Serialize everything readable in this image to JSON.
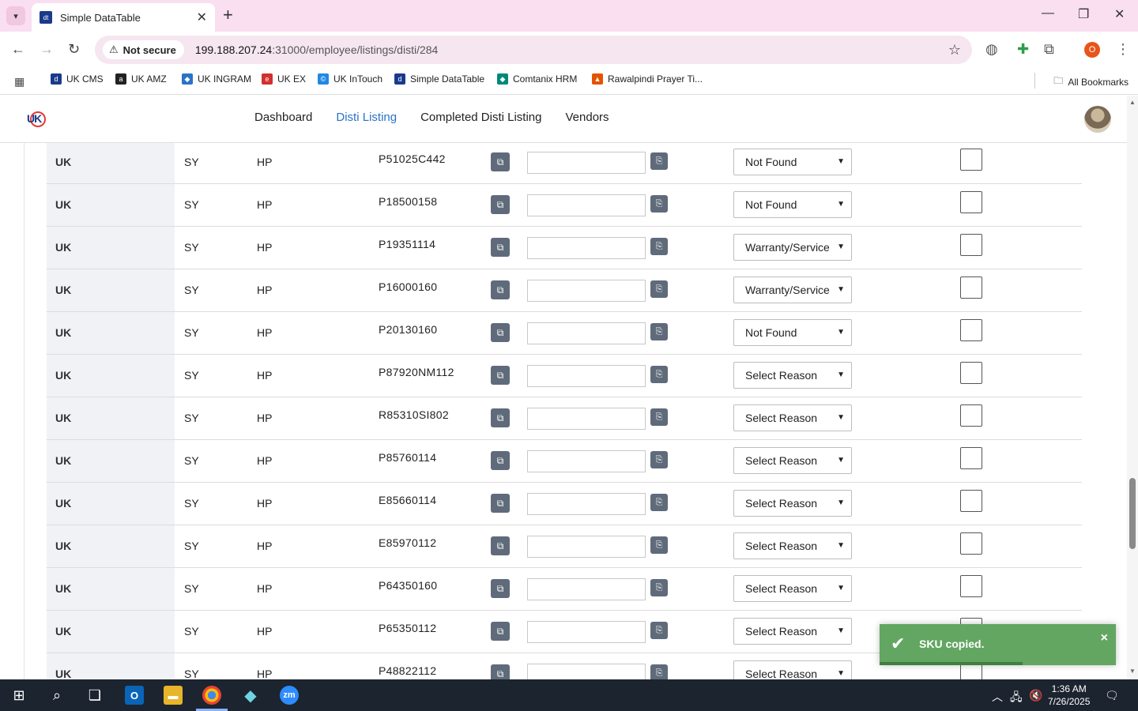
{
  "browser": {
    "tab_title": "Simple DataTable",
    "favicon_text": "dt",
    "new_tab_label": "+",
    "security_label": "Not secure",
    "url_host": "199.188.207.24",
    "url_path": ":31000/employee/listings/disti/284",
    "profile_initial": "O",
    "bookmarks": [
      {
        "label": "UK CMS",
        "icon": "dt-icon",
        "color": "#1a3a8c",
        "glyph": "d"
      },
      {
        "label": "UK AMZ",
        "icon": "amazon-icon",
        "color": "#222222",
        "glyph": "a"
      },
      {
        "label": "UK INGRAM",
        "icon": "ingram-icon",
        "color": "#2a73c8",
        "glyph": "◆"
      },
      {
        "label": "UK EX",
        "icon": "ex-icon",
        "color": "#d32f2f",
        "glyph": "e"
      },
      {
        "label": "UK InTouch",
        "icon": "intouch-icon",
        "color": "#1e88e5",
        "glyph": "©"
      },
      {
        "label": "Simple DataTable",
        "icon": "dt-icon",
        "color": "#1a3a8c",
        "glyph": "d"
      },
      {
        "label": "Comtanix HRM",
        "icon": "comtanix-icon",
        "color": "#00897b",
        "glyph": "◆"
      },
      {
        "label": "Rawalpindi Prayer Ti...",
        "icon": "prayer-icon",
        "color": "#e65100",
        "glyph": "▲"
      }
    ],
    "all_bookmarks_label": "All Bookmarks"
  },
  "site": {
    "nav": [
      {
        "label": "Dashboard",
        "active": false
      },
      {
        "label": "Disti Listing",
        "active": true
      },
      {
        "label": "Completed Disti Listing",
        "active": false
      },
      {
        "label": "Vendors",
        "active": false
      }
    ]
  },
  "table": {
    "rows": [
      {
        "region": "UK",
        "dist": "SY",
        "brand": "HP",
        "sku": "P51025C442",
        "reason": "Not Found"
      },
      {
        "region": "UK",
        "dist": "SY",
        "brand": "HP",
        "sku": "P18500158",
        "reason": "Not Found"
      },
      {
        "region": "UK",
        "dist": "SY",
        "brand": "HP",
        "sku": "P19351114",
        "reason": "Warranty/Service"
      },
      {
        "region": "UK",
        "dist": "SY",
        "brand": "HP",
        "sku": "P16000160",
        "reason": "Warranty/Service"
      },
      {
        "region": "UK",
        "dist": "SY",
        "brand": "HP",
        "sku": "P20130160",
        "reason": "Not Found"
      },
      {
        "region": "UK",
        "dist": "SY",
        "brand": "HP",
        "sku": "P87920NM112",
        "reason": "Select Reason"
      },
      {
        "region": "UK",
        "dist": "SY",
        "brand": "HP",
        "sku": "R85310SI802",
        "reason": "Select Reason"
      },
      {
        "region": "UK",
        "dist": "SY",
        "brand": "HP",
        "sku": "P85760114",
        "reason": "Select Reason"
      },
      {
        "region": "UK",
        "dist": "SY",
        "brand": "HP",
        "sku": "E85660114",
        "reason": "Select Reason"
      },
      {
        "region": "UK",
        "dist": "SY",
        "brand": "HP",
        "sku": "E85970112",
        "reason": "Select Reason"
      },
      {
        "region": "UK",
        "dist": "SY",
        "brand": "HP",
        "sku": "P64350160",
        "reason": "Select Reason"
      },
      {
        "region": "UK",
        "dist": "SY",
        "brand": "HP",
        "sku": "P65350112",
        "reason": "Select Reason"
      },
      {
        "region": "UK",
        "dist": "SY",
        "brand": "HP",
        "sku": "P48822112",
        "reason": "Select Reason"
      }
    ]
  },
  "toast": {
    "message": "SKU copied.",
    "close_glyph": "×",
    "color": "#62a662"
  },
  "taskbar": {
    "time": "1:36 AM",
    "date": "7/26/2025"
  }
}
